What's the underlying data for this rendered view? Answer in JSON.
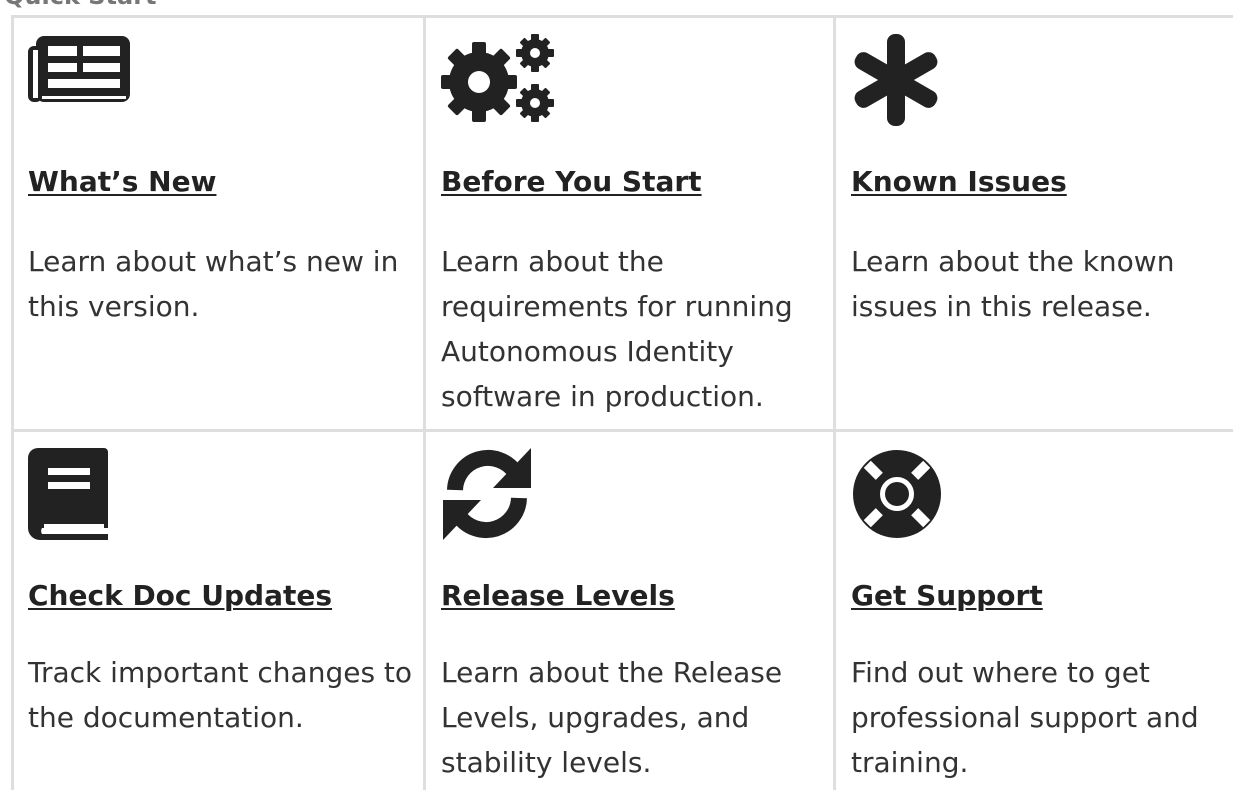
{
  "section": {
    "heading": "Quick Start"
  },
  "colors": {
    "icon": "#222222",
    "grid_line": "#dedede",
    "text": "#333333"
  },
  "cards": [
    {
      "icon": "newspaper-icon",
      "title": "What’s New",
      "description": "Learn about what’s new in this version."
    },
    {
      "icon": "gears-icon",
      "title": "Before You Start",
      "description": "Learn about the requirements for running Autonomous Identity software in production."
    },
    {
      "icon": "asterisk-icon",
      "title": "Known Issues",
      "description": "Learn about the known issues in this release."
    },
    {
      "icon": "book-icon",
      "title": "Check Doc Updates",
      "description": "Track important changes to the documentation."
    },
    {
      "icon": "refresh-icon",
      "title": "Release Levels",
      "description": "Learn about the Release Levels, upgrades, and stability levels."
    },
    {
      "icon": "life-ring-icon",
      "title": "Get Support",
      "description": "Find out where to get professional support and training."
    }
  ]
}
